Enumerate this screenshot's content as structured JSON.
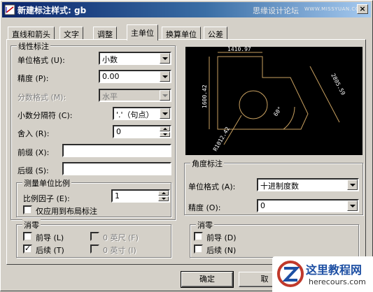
{
  "window": {
    "title": "新建标注样式: gb",
    "watermark": "思缘设计论坛",
    "watermark_en": "WWW.MISSYUAN.COM",
    "close_label": "×"
  },
  "tabs": [
    {
      "label": "直线和箭头",
      "active": false
    },
    {
      "label": "文字",
      "active": false
    },
    {
      "label": "调整",
      "active": false
    },
    {
      "label": "主单位",
      "active": true
    },
    {
      "label": "换算单位",
      "active": false
    },
    {
      "label": "公差",
      "active": false
    }
  ],
  "linear": {
    "title": "线性标注",
    "unit_format_label": "单位格式 (U):",
    "unit_format_value": "小数",
    "precision_label": "精度 (P):",
    "precision_value": "0.00",
    "fraction_label": "分数格式 (M):",
    "fraction_value": "水平",
    "decimal_sep_label": "小数分隔符 (C):",
    "decimal_sep_value": "'.'（句点）",
    "round_label": "舍入 (R):",
    "round_value": "0",
    "prefix_label": "前缀 (X):",
    "prefix_value": "",
    "suffix_label": "后缀 (S):",
    "suffix_value": ""
  },
  "scale": {
    "title": "测量单位比例",
    "factor_label": "比例因子 (E):",
    "factor_value": "1",
    "layout_only_label": "仅应用到布局标注"
  },
  "zero_linear": {
    "title": "消零",
    "leading_label": "前导 (L)",
    "trailing_label": "后续 (T)",
    "feet_label": "0 英尺 (F)",
    "inches_label": "0 英寸 (I)",
    "leading_checked": false,
    "trailing_checked": true
  },
  "angular": {
    "title": "角度标注",
    "unit_format_label": "单位格式 (A):",
    "unit_format_value": "十进制度数",
    "precision_label": "精度 (O):",
    "precision_value": "0"
  },
  "zero_angular": {
    "title": "消零",
    "leading_label": "前导 (D)",
    "trailing_label": "后续 (N)"
  },
  "preview": {
    "dim_top": "1410.97",
    "dim_left": "1600.42",
    "dim_right": "2805.59",
    "dim_angle": "60°",
    "dim_radius": "R1012.42",
    "line_color": "#c8a060",
    "text_color": "#ffffff"
  },
  "buttons": {
    "ok_label": "确定",
    "cancel_label": "取"
  },
  "logo": {
    "cn": "这里教程网",
    "en": "herecours.com"
  }
}
